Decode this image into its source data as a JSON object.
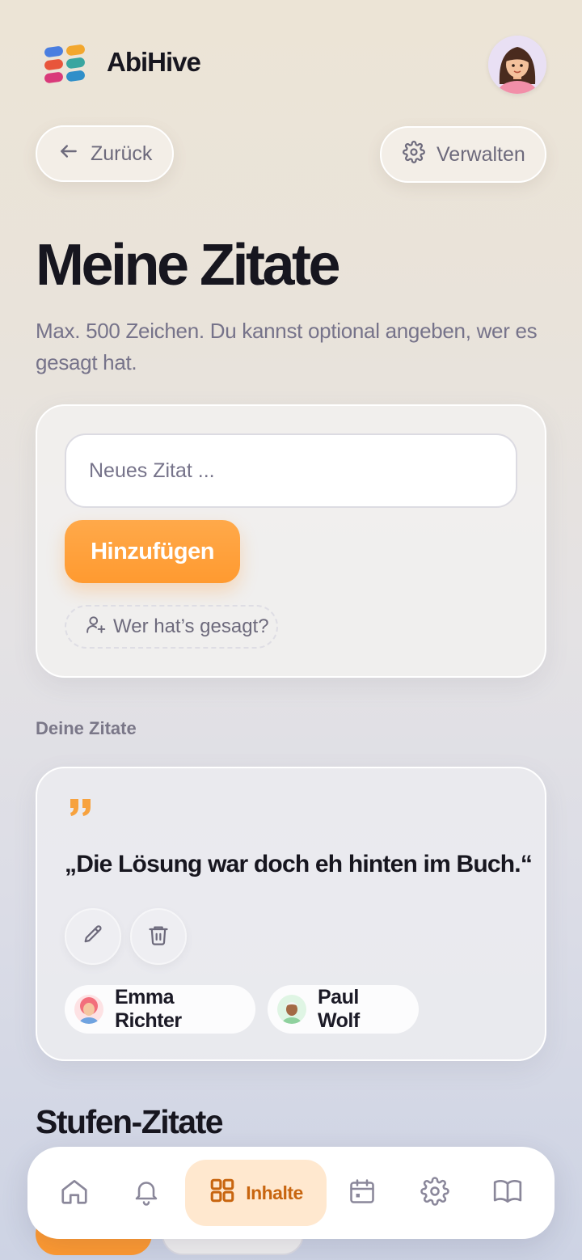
{
  "header": {
    "brand": "AbiHive",
    "logo_icon": "abihive-logo-icon",
    "avatar_icon": "user-avatar"
  },
  "toolbar": {
    "back_label": "Zurück",
    "manage_label": "Verwalten"
  },
  "page": {
    "title": "Meine Zitate",
    "subtitle": "Max. 500 Zeichen. Du kannst optional angeben, wer es gesagt hat."
  },
  "composer": {
    "input_placeholder": "Neues Zitat ...",
    "input_value": "",
    "add_label": "Hinzufügen",
    "who_label": "Wer hat’s gesagt?"
  },
  "my_quotes": {
    "section_label": "Deine Zitate",
    "items": [
      {
        "text": "„Die Lösung war doch eh hinten im Buch.“",
        "people": [
          {
            "name": "Emma Richter"
          },
          {
            "name": "Paul Wolf"
          }
        ]
      }
    ]
  },
  "grade_quotes": {
    "section_title": "Stufen-Zitate"
  },
  "nav": {
    "active_label": "Inhalte",
    "items": [
      "home-icon",
      "bell-icon",
      "grid-icon",
      "calendar-icon",
      "gear-icon",
      "book-icon"
    ]
  },
  "colors": {
    "accent": "#ff9a30",
    "accent_text": "#c8650f",
    "active_nav_bg": "#ffe8cf",
    "title": "#17161f",
    "muted": "#76738a"
  }
}
